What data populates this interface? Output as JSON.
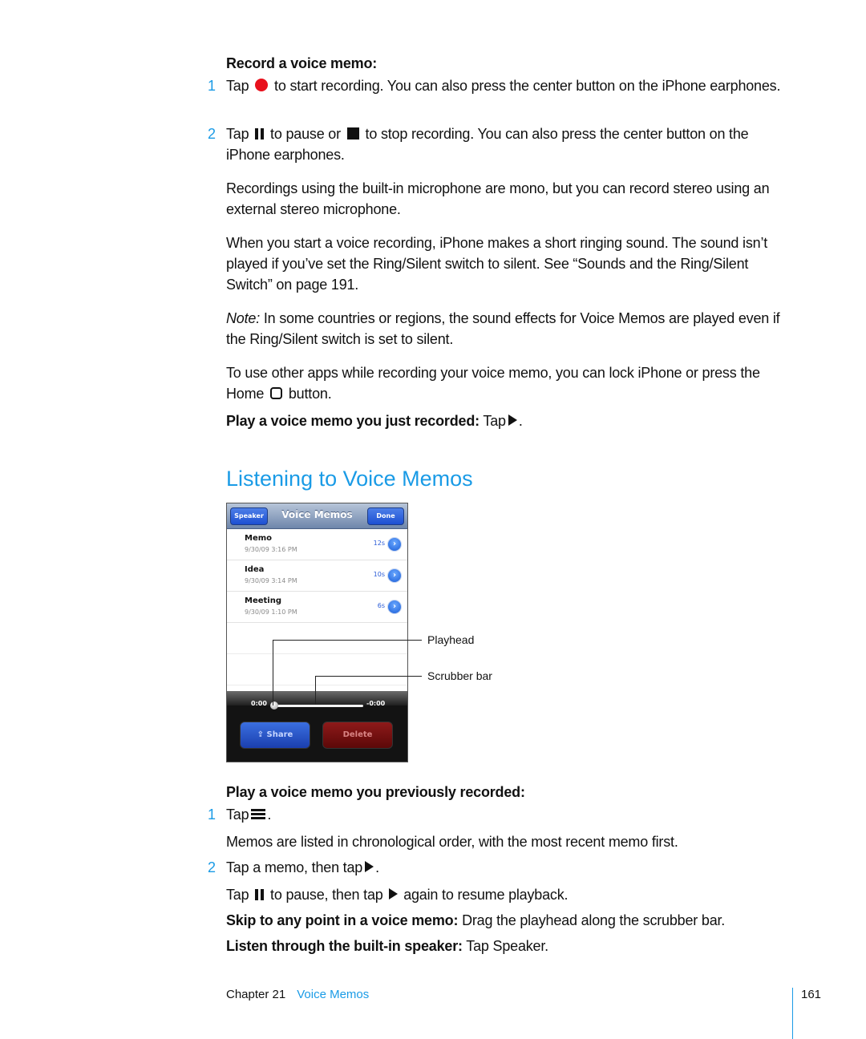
{
  "record_section": {
    "heading": "Record a voice memo:",
    "steps": [
      {
        "num": "1",
        "pre": "Tap",
        "icon": "record-dot-icon",
        "text": "to start recording. You can also press the center button on the iPhone earphones."
      },
      {
        "num": "2",
        "pre": "Tap",
        "icon": "pause-icon",
        "mid": "to pause or",
        "icon2": "stop-icon",
        "text": "to stop recording. You can also press the center button on the iPhone earphones."
      }
    ],
    "para_stereo": "Recordings using the built-in microphone are mono, but you can record stereo using an external stereo microphone.",
    "para_ringing": "When you start a voice recording, iPhone makes a short ringing sound. The sound isn’t played if you’ve set the Ring/Silent switch to silent. See “Sounds and the Ring/Silent Switch” on page 191.",
    "note_label": "Note:",
    "note_text": "In some countries or regions, the sound effects for Voice Memos are played even if the Ring/Silent switch is set to silent.",
    "para_other_apps_pre": "To use other apps while recording your voice memo, you can lock iPhone or press the Home",
    "para_other_apps_post": "button.",
    "play_just_label": "Play a voice memo you just recorded:",
    "play_just_text": "Tap",
    "play_just_end": "."
  },
  "listening_section": {
    "heading": "Listening to Voice Memos",
    "phone": {
      "nav_left": "Speaker",
      "nav_title": "Voice Memos",
      "nav_right": "Done",
      "memos": [
        {
          "title": "Memo",
          "date": "9/30/09 3:16 PM",
          "duration": "12s"
        },
        {
          "title": "Idea",
          "date": "9/30/09 3:14 PM",
          "duration": "10s"
        },
        {
          "title": "Meeting",
          "date": "9/30/09 1:10 PM",
          "duration": "6s"
        }
      ],
      "elapsed": "0:00",
      "remaining": "-0:00",
      "playback_progress": 0,
      "share_label": "Share",
      "delete_label": "Delete"
    },
    "callouts": {
      "playhead": "Playhead",
      "scrubber": "Scrubber bar"
    },
    "play_prev_heading": "Play a voice memo you previously recorded:",
    "steps": [
      {
        "num": "1",
        "pre": "Tap",
        "icon": "list-icon",
        "end": "."
      },
      {
        "num": "2",
        "pre": "Tap a memo, then tap",
        "icon": "play-icon",
        "end": "."
      }
    ],
    "para_chrono": "Memos are listed in chronological order, with the most recent memo first.",
    "para_pause_pre": "Tap",
    "para_pause_mid": "to pause, then tap",
    "para_pause_post": "again to resume playback.",
    "skip_label": "Skip to any point in a voice memo:",
    "skip_text": "Drag the playhead along the scrubber bar.",
    "speaker_label": "Listen through the built-in speaker:",
    "speaker_text": "Tap Speaker."
  },
  "footer": {
    "chapter": "Chapter 21",
    "title": "Voice Memos",
    "page": "161"
  },
  "colors": {
    "accent": "#1a9be6",
    "record": "#e8101c"
  }
}
